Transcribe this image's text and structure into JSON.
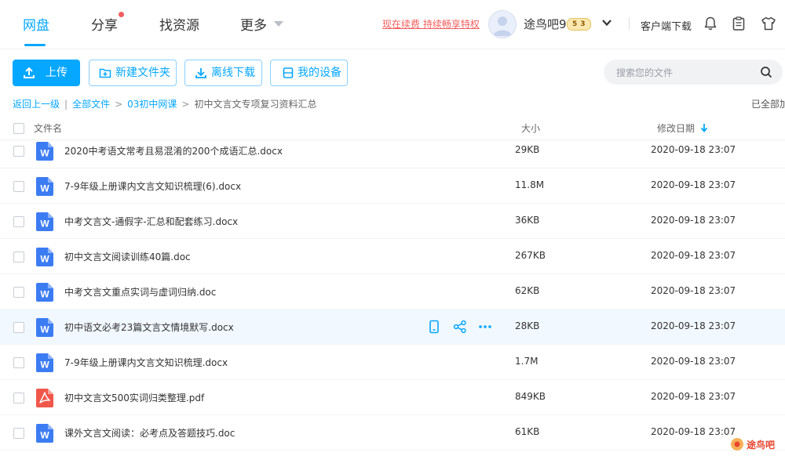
{
  "nav": {
    "tabs": [
      {
        "label": "网盘"
      },
      {
        "label": "分享"
      },
      {
        "label": "找资源"
      },
      {
        "label": "更多"
      }
    ],
    "promo": "现在续费 持续畅享特权",
    "username": "途鸟吧9",
    "vip_level_1": "5",
    "vip_level_2": "3",
    "client_download": "客户端下载"
  },
  "toolbar": {
    "upload": "上传",
    "new_folder": "新建文件夹",
    "offline_download": "离线下载",
    "my_devices": "我的设备",
    "search_placeholder": "搜索您的文件"
  },
  "breadcrumb": {
    "back": "返回上一级",
    "all_files": "全部文件",
    "folder": "03初中网课",
    "current": "初中文言文专项复习资料汇总",
    "loaded_status": "已全部加"
  },
  "columns": {
    "name": "文件名",
    "size": "大小",
    "modified": "修改日期"
  },
  "colors": {
    "accent": "#06a7ff",
    "promo": "#f25d5d",
    "word_icon": "#3c7cf3",
    "pdf_icon": "#f0574a"
  },
  "files": [
    {
      "name": "2020中考语文常考且易混淆的200个成语汇总.docx",
      "size": "29KB",
      "date": "2020-09-18 23:07",
      "type": "word-icon"
    },
    {
      "name": "7-9年级上册课内文言文知识梳理(6).docx",
      "size": "11.8M",
      "date": "2020-09-18 23:07",
      "type": "word-icon"
    },
    {
      "name": "中考文言文-通假字-汇总和配套练习.docx",
      "size": "36KB",
      "date": "2020-09-18 23:07",
      "type": "word-icon"
    },
    {
      "name": "初中文言文阅读训练40篇.doc",
      "size": "267KB",
      "date": "2020-09-18 23:07",
      "type": "word-icon"
    },
    {
      "name": "中考文言文重点实词与虚词归纳.doc",
      "size": "62KB",
      "date": "2020-09-18 23:07",
      "type": "word-icon"
    },
    {
      "name": "初中语文必考23篇文言文情境默写.docx",
      "size": "28KB",
      "date": "2020-09-18 23:07",
      "type": "word-icon"
    },
    {
      "name": "7-9年级上册课内文言文知识梳理.docx",
      "size": "1.7M",
      "date": "2020-09-18 23:07",
      "type": "word-icon"
    },
    {
      "name": "初中文言文500实词归类整理.pdf",
      "size": "849KB",
      "date": "2020-09-18 23:07",
      "type": "pdf-icon"
    },
    {
      "name": "课外文言文阅读：必考点及答题技巧.doc",
      "size": "61KB",
      "date": "2020-09-18 23:07",
      "type": "word-icon"
    }
  ],
  "watermark": "途鸟吧"
}
